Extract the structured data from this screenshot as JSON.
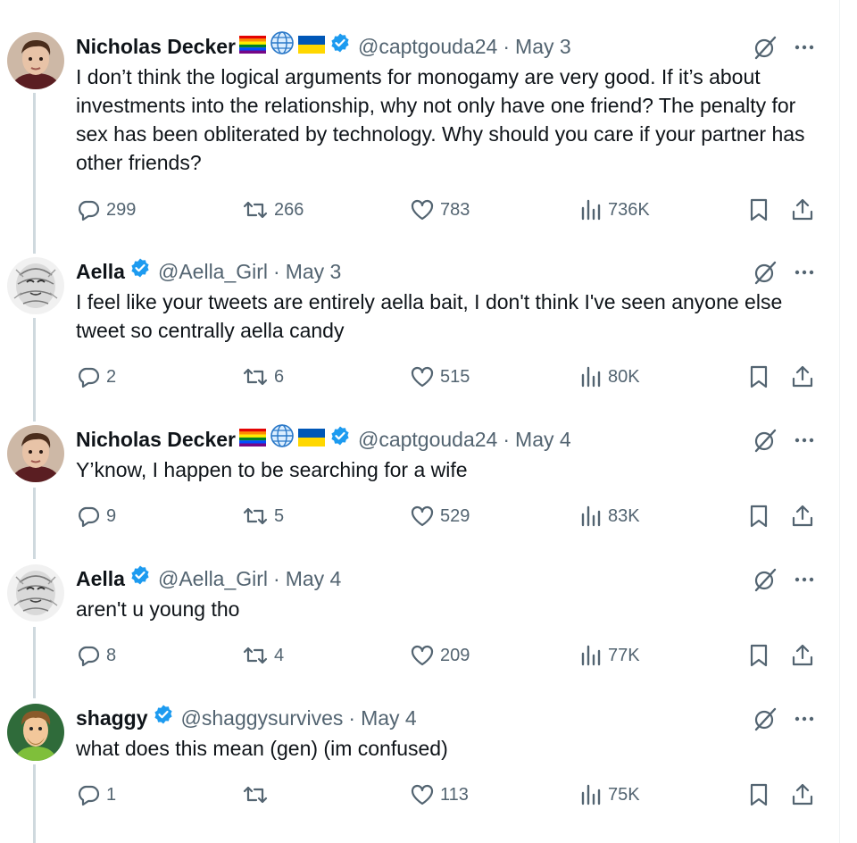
{
  "colors": {
    "verified": "#1d9bf0",
    "muted": "#536471",
    "text": "#0f1419",
    "thread_line": "#cfd9de"
  },
  "icons": [
    "reply-icon",
    "retweet-icon",
    "like-icon",
    "views-icon",
    "bookmark-icon",
    "share-icon",
    "grok-icon",
    "more-icon",
    "verified-badge-icon"
  ],
  "tweets": [
    {
      "name": "Nicholas Decker",
      "handle": "@captgouda24",
      "date": "May 3",
      "text": "I don’t think the logical arguments for monogamy are very good. If it’s about investments into the relationship, why not only have one friend? The penalty for sex has been obliterated by technology. Why should you care if your partner has other friends?",
      "replies": "299",
      "retweets": "266",
      "likes": "783",
      "views": "736K",
      "flags": [
        "rainbow-flag",
        "globe",
        "ukraine-flag"
      ]
    },
    {
      "name": "Aella",
      "handle": "@Aella_Girl",
      "date": "May 3",
      "text": "I feel like your tweets are entirely aella bait, I don't think I've seen anyone else tweet so centrally aella candy",
      "replies": "2",
      "retweets": "6",
      "likes": "515",
      "views": "80K"
    },
    {
      "name": "Nicholas Decker",
      "handle": "@captgouda24",
      "date": "May 4",
      "text": "Y’know, I happen to be searching for a wife",
      "replies": "9",
      "retweets": "5",
      "likes": "529",
      "views": "83K",
      "flags": [
        "rainbow-flag",
        "globe",
        "ukraine-flag"
      ]
    },
    {
      "name": "Aella",
      "handle": "@Aella_Girl",
      "date": "May 4",
      "text": "aren't u young tho",
      "replies": "8",
      "retweets": "4",
      "likes": "209",
      "views": "77K"
    },
    {
      "name": "shaggy",
      "handle": "@shaggysurvives",
      "date": "May 4",
      "text": "what does this mean (gen) (im confused)",
      "replies": "1",
      "retweets": "",
      "likes": "113",
      "views": "75K"
    }
  ],
  "separator": "·"
}
